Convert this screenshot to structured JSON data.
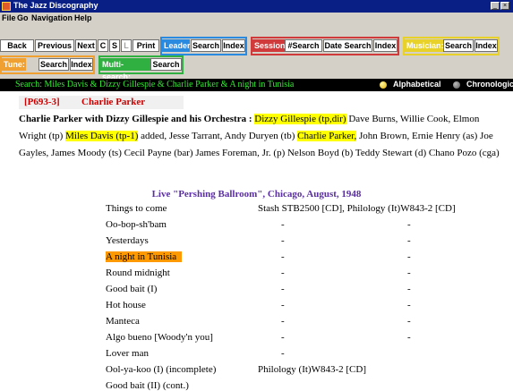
{
  "window": {
    "title": "The Jazz Discography"
  },
  "menu": [
    "File",
    "Go",
    "Navigation",
    "Help"
  ],
  "toolbar": {
    "nav": [
      "Back",
      "Previous",
      "Next",
      "C",
      "S",
      "L",
      "Print"
    ],
    "leader": {
      "label": "Leader:",
      "buttons": [
        "Search",
        "Index"
      ],
      "color": "#2a8ae0"
    },
    "session": {
      "label": "Session:",
      "buttons": [
        "#Search",
        "Date Search",
        "Index"
      ],
      "color": "#d03a3a"
    },
    "musician": {
      "label": "Musician:",
      "buttons": [
        "Search",
        "Index"
      ],
      "color": "#e8d22a"
    },
    "tune": {
      "label": "Tune:",
      "buttons": [
        "Search",
        "Index"
      ],
      "color": "#f0a030"
    },
    "multi": {
      "label": "Multi-search:",
      "buttons": [
        "Search"
      ],
      "color": "#30b040"
    }
  },
  "searchbar": {
    "text": "Search: Miles Davis & Dizzy Gillespie & Charlie Parker & A night in Tunisia",
    "alphabetical": "Alphabetical",
    "chronological": "Chronological"
  },
  "result": {
    "id": "[P693-3]",
    "leader": "Charlie Parker",
    "band": "Charlie Parker with Dizzy Gillespie and his Orchestra : ",
    "personnel": [
      {
        "t": "Dizzy Gillespie (tp,dir)",
        "hl": true
      },
      {
        "t": " Dave Burns, Willie Cook, Elmon Wright (tp) ",
        "hl": false
      },
      {
        "t": "Miles Davis (tp-1)",
        "hl": true
      },
      {
        "t": " added, Jesse Tarrant, Andy Duryen (tb) ",
        "hl": false
      },
      {
        "t": "Charlie Parker,",
        "hl": true
      },
      {
        "t": " John Brown, Ernie Henry (as) Joe Gayles, James Moody (ts) Cecil Payne (bar) James Foreman, Jr. (p) Nelson Boyd (b) Teddy Stewart (d) Chano Pozo (cga)",
        "hl": false
      }
    ],
    "session": "Live \"Pershing Ballroom\", Chicago, August, 1948",
    "tracks": [
      {
        "title": "Things to come",
        "issue1": "Stash STB2500 [CD], Philology (It)W843-2 [CD]",
        "issue2": ""
      },
      {
        "title": "Oo-bop-sh'bam",
        "issue1": "-",
        "issue2": "-"
      },
      {
        "title": "Yesterdays",
        "issue1": "-",
        "issue2": "-"
      },
      {
        "title": "A night in Tunisia",
        "issue1": "-",
        "issue2": "-",
        "selected": true
      },
      {
        "title": "Round midnight",
        "issue1": "-",
        "issue2": "-"
      },
      {
        "title": "Good bait (I)",
        "issue1": "-",
        "issue2": "-"
      },
      {
        "title": "Hot house",
        "issue1": "-",
        "issue2": "-"
      },
      {
        "title": "Manteca",
        "issue1": "-",
        "issue2": "-"
      },
      {
        "title": "Algo bueno [Woody'n you]",
        "issue1": "-",
        "issue2": "-"
      },
      {
        "title": "Lover man",
        "issue1": "-",
        "issue2": ""
      },
      {
        "title": "Ool-ya-koo (I) (incomplete)",
        "issue1": "Philology (It)W843-2 [CD]",
        "issue2": ""
      },
      {
        "title": "Good bait (II) (cont.)",
        "issue1": "",
        "issue2": ""
      }
    ]
  }
}
